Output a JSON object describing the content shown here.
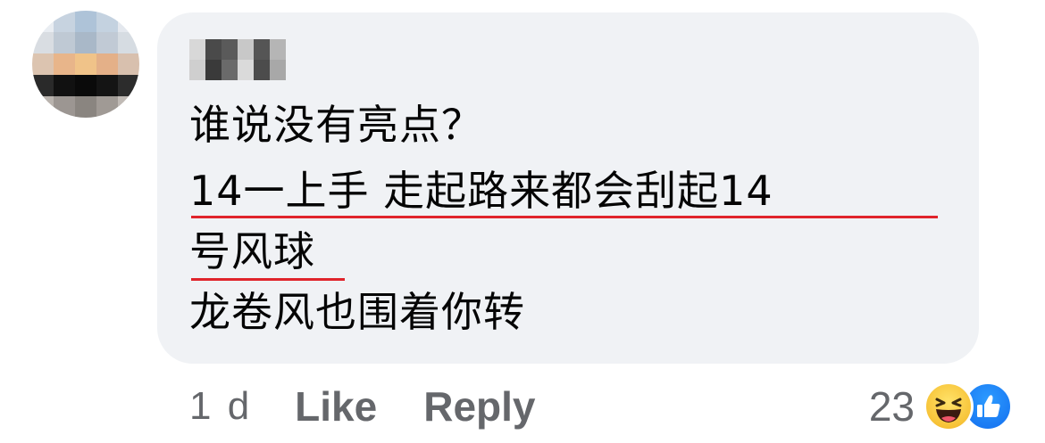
{
  "comment": {
    "author_name": "",
    "lines": [
      "谁说没有亮点？",
      "14一上手  走起路来都会刮起14",
      "号风球",
      "龙卷风也围着你转"
    ],
    "highlight_color": "#e0242b"
  },
  "actions": {
    "timestamp": "1 d",
    "like_label": "Like",
    "reply_label": "Reply"
  },
  "reactions": {
    "count": "23",
    "icons": [
      "haha-icon",
      "like-icon"
    ]
  },
  "colors": {
    "bubble_bg": "#f0f2f5",
    "text": "#050505",
    "secondary_text": "#65676b",
    "like_blue": "#1877f2"
  }
}
